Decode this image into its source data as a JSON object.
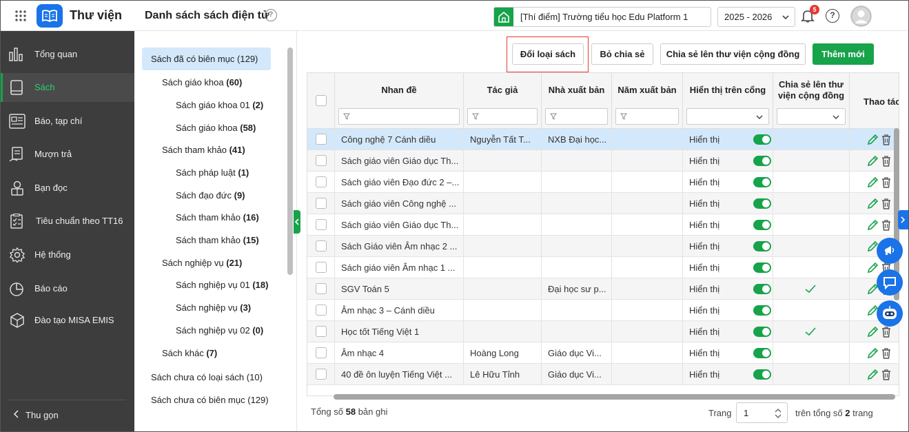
{
  "header": {
    "app_name": "Thư viện",
    "page_title": "Danh sách sách điện tử",
    "help_small": "?",
    "school": "[Thí điểm] Trường tiểu học Edu Platform 1",
    "year": "2025 - 2026",
    "notification_count": "5",
    "help": "?"
  },
  "sidebar": {
    "items": [
      {
        "label": "Tổng quan",
        "icon": "dashboard-icon"
      },
      {
        "label": "Sách",
        "icon": "book-icon",
        "active": true
      },
      {
        "label": "Báo, tạp chí",
        "icon": "newspaper-icon"
      },
      {
        "label": "Mượn trả",
        "icon": "borrow-icon"
      },
      {
        "label": "Bạn đọc",
        "icon": "reader-icon"
      },
      {
        "label": "Tiêu chuẩn theo TT16",
        "icon": "checklist-icon"
      },
      {
        "label": "Hệ thống",
        "icon": "gear-icon"
      },
      {
        "label": "Báo cáo",
        "icon": "pie-chart-icon"
      },
      {
        "label": "Đào tạo MISA EMIS",
        "icon": "cube-icon"
      }
    ],
    "collapse": "Thu gọn"
  },
  "tree": {
    "items": [
      {
        "label": "Sách đã có biên mục",
        "count": "(129)"
      },
      {
        "label": "Sách giáo khoa",
        "count": "(60)"
      },
      {
        "label": "Sách giáo khoa 01",
        "count": "(2)"
      },
      {
        "label": "Sách giáo khoa",
        "count": "(58)"
      },
      {
        "label": "Sách tham khảo",
        "count": "(41)"
      },
      {
        "label": "Sách pháp luật",
        "count": "(1)"
      },
      {
        "label": "Sách đạo đức",
        "count": "(9)"
      },
      {
        "label": "Sách tham khảo",
        "count": "(16)"
      },
      {
        "label": "Sách tham khảo",
        "count": "(15)"
      },
      {
        "label": "Sách nghiệp vụ",
        "count": "(21)"
      },
      {
        "label": "Sách nghiệp vụ 01",
        "count": "(18)"
      },
      {
        "label": "Sách nghiệp vụ",
        "count": "(3)"
      },
      {
        "label": "Sách nghiệp vụ 02",
        "count": "(0)"
      },
      {
        "label": "Sách khác",
        "count": "(7)"
      },
      {
        "label": "Sách chưa có loại sách",
        "count": "(10)"
      },
      {
        "label": "Sách chưa có biên mục",
        "count": "(129)"
      }
    ]
  },
  "toolbar": {
    "change_type": "Đổi loại sách",
    "unshare": "Bỏ chia sẻ",
    "share_community": "Chia sẻ lên thư viện cộng đồng",
    "add_new": "Thêm mới"
  },
  "table": {
    "columns": {
      "title": "Nhan đề",
      "author": "Tác giả",
      "publisher": "Nhà xuất bản",
      "year": "Năm xuất bản",
      "show_portal": "Hiển thị trên cổng",
      "share_line1": "Chia sẻ lên thư",
      "share_line2": "viện cộng đồng",
      "actions": "Thao tác"
    },
    "rows": [
      {
        "title": "Công nghệ 7 Cánh diều",
        "author": "Nguyễn Tất T...",
        "publisher": "NXB Đại học...",
        "year": "",
        "show": "Hiển thị",
        "shared": false
      },
      {
        "title": "Sách giáo viên Giáo dục Th...",
        "author": "",
        "publisher": "",
        "year": "",
        "show": "Hiển thị",
        "shared": false
      },
      {
        "title": "Sách giáo viên Đạo đức 2 –...",
        "author": "",
        "publisher": "",
        "year": "",
        "show": "Hiển thị",
        "shared": false
      },
      {
        "title": "Sách giáo viên Công nghệ ...",
        "author": "",
        "publisher": "",
        "year": "",
        "show": "Hiển thị",
        "shared": false
      },
      {
        "title": "Sách giáo viên Giáo dục Th...",
        "author": "",
        "publisher": "",
        "year": "",
        "show": "Hiển thị",
        "shared": false
      },
      {
        "title": "Sách Giáo viên Âm nhạc 2 ...",
        "author": "",
        "publisher": "",
        "year": "",
        "show": "Hiển thị",
        "shared": false
      },
      {
        "title": "Sách giáo viên Âm nhạc 1 ...",
        "author": "",
        "publisher": "",
        "year": "",
        "show": "Hiển thị",
        "shared": false
      },
      {
        "title": "SGV Toán 5",
        "author": "",
        "publisher": "Đại học sư p...",
        "year": "",
        "show": "Hiển thị",
        "shared": true
      },
      {
        "title": "Âm nhạc 3 – Cánh diều",
        "author": "",
        "publisher": "",
        "year": "",
        "show": "Hiển thị",
        "shared": false
      },
      {
        "title": "Học tốt Tiếng Việt 1",
        "author": "",
        "publisher": "",
        "year": "",
        "show": "Hiển thị",
        "shared": true
      },
      {
        "title": "Âm nhạc 4",
        "author": "Hoàng Long",
        "publisher": "Giáo dục Vi...",
        "year": "",
        "show": "Hiển thị",
        "shared": false
      },
      {
        "title": "40 đề ôn luyện Tiếng Việt ...",
        "author": "Lê Hữu Tỉnh",
        "publisher": "Giáo dục Vi...",
        "year": "",
        "show": "Hiển thị",
        "shared": false
      }
    ]
  },
  "footer": {
    "total_prefix": "Tổng số",
    "total_count": "58",
    "total_suffix": "bản ghi",
    "page_label": "Trang",
    "page_value": "1",
    "pages_prefix": "trên tổng số",
    "pages_count": "2",
    "pages_suffix": "trang"
  },
  "colors": {
    "accent": "#17a34a",
    "brand": "#1a73e8",
    "sidebar": "#3d3d3d",
    "highlight": "#d4e8fb",
    "annotation": "#e53935"
  }
}
